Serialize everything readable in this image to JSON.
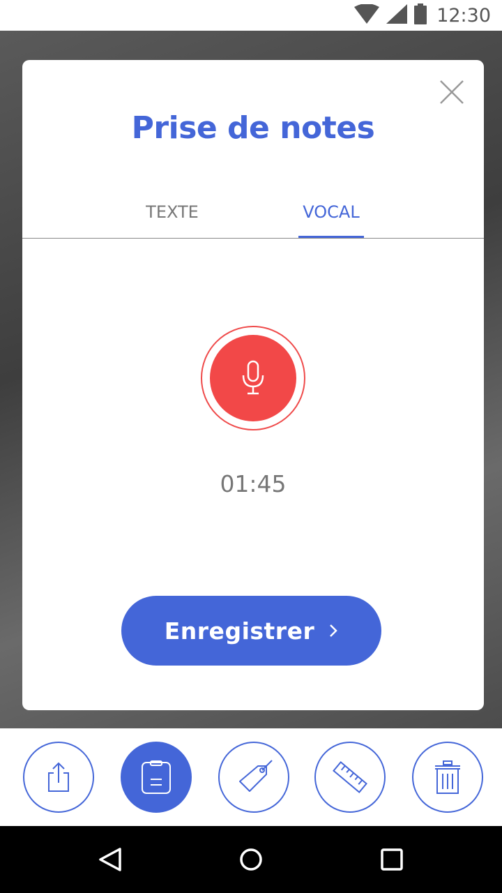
{
  "status_bar": {
    "time": "12:30",
    "icons": [
      "wifi-icon",
      "signal-icon",
      "battery-icon"
    ]
  },
  "modal": {
    "title": "Prise de notes",
    "close_icon": "close-icon",
    "tabs": [
      {
        "label": "TEXTE",
        "active": false
      },
      {
        "label": "VOCAL",
        "active": true
      }
    ],
    "recorder": {
      "icon": "microphone-icon",
      "timer": "01:45"
    },
    "save_button": {
      "label": "Enregistrer",
      "icon": "chevron-right-icon"
    }
  },
  "toolbar": {
    "items": [
      {
        "icon": "share-icon",
        "active": false
      },
      {
        "icon": "clipboard-icon",
        "active": true
      },
      {
        "icon": "tag-icon",
        "active": false
      },
      {
        "icon": "ruler-icon",
        "active": false
      },
      {
        "icon": "trash-icon",
        "active": false
      }
    ]
  },
  "navbar": {
    "items": [
      "back-icon",
      "home-icon",
      "recents-icon"
    ]
  },
  "colors": {
    "accent": "#4466d8",
    "record": "#f24848",
    "text_muted": "#777777"
  }
}
